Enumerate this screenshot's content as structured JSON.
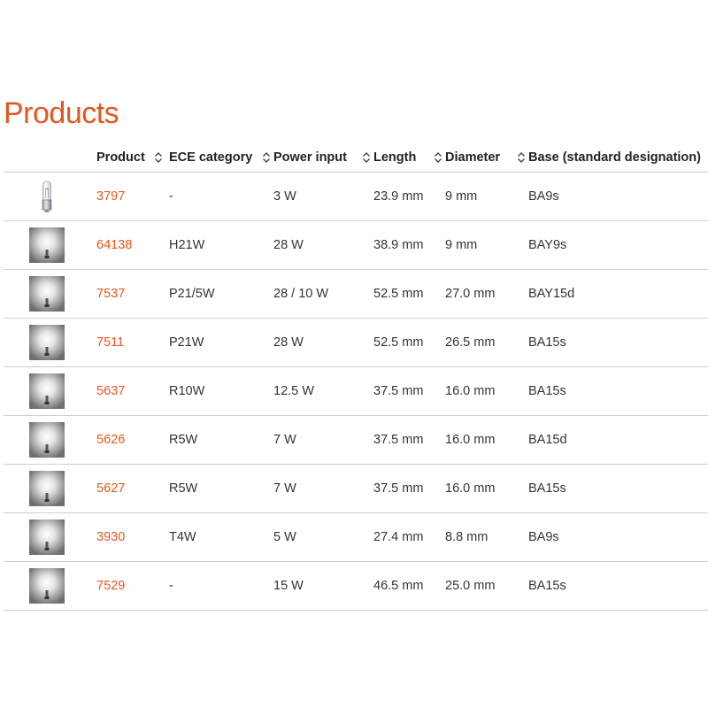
{
  "page": {
    "title": "Products"
  },
  "columns": [
    {
      "key": "product",
      "label": "Product"
    },
    {
      "key": "ece",
      "label": "ECE category"
    },
    {
      "key": "power",
      "label": "Power input"
    },
    {
      "key": "length",
      "label": "Length"
    },
    {
      "key": "diameter",
      "label": "Diameter"
    },
    {
      "key": "base",
      "label": "Base (standard designation)"
    }
  ],
  "rows": [
    {
      "product": "3797",
      "ece": "-",
      "power": "3 W",
      "length": "23.9 mm",
      "diameter": "9 mm",
      "base": "BA9s",
      "image": "bulb-photo-icon"
    },
    {
      "product": "64138",
      "ece": "H21W",
      "power": "28 W",
      "length": "38.9 mm",
      "diameter": "9 mm",
      "base": "BAY9s",
      "image": "lamp-glow-icon"
    },
    {
      "product": "7537",
      "ece": "P21/5W",
      "power": "28 / 10 W",
      "length": "52.5 mm",
      "diameter": "27.0 mm",
      "base": "BAY15d",
      "image": "lamp-glow-icon"
    },
    {
      "product": "7511",
      "ece": "P21W",
      "power": "28 W",
      "length": "52.5 mm",
      "diameter": "26.5 mm",
      "base": "BA15s",
      "image": "lamp-glow-icon"
    },
    {
      "product": "5637",
      "ece": "R10W",
      "power": "12.5 W",
      "length": "37.5 mm",
      "diameter": "16.0 mm",
      "base": "BA15s",
      "image": "lamp-glow-icon"
    },
    {
      "product": "5626",
      "ece": "R5W",
      "power": "7 W",
      "length": "37.5 mm",
      "diameter": "16.0 mm",
      "base": "BA15d",
      "image": "lamp-glow-icon"
    },
    {
      "product": "5627",
      "ece": "R5W",
      "power": "7 W",
      "length": "37.5 mm",
      "diameter": "16.0 mm",
      "base": "BA15s",
      "image": "lamp-glow-icon"
    },
    {
      "product": "3930",
      "ece": "T4W",
      "power": "5 W",
      "length": "27.4 mm",
      "diameter": "8.8 mm",
      "base": "BA9s",
      "image": "lamp-glow-icon"
    },
    {
      "product": "7529",
      "ece": "-",
      "power": "15 W",
      "length": "46.5 mm",
      "diameter": "25.0 mm",
      "base": "BA15s",
      "image": "lamp-glow-icon"
    }
  ],
  "colors": {
    "accent": "#e2591f",
    "text": "#333333",
    "divider": "#cfcfcf"
  },
  "icons": {
    "sort": "sort-arrows-icon"
  }
}
